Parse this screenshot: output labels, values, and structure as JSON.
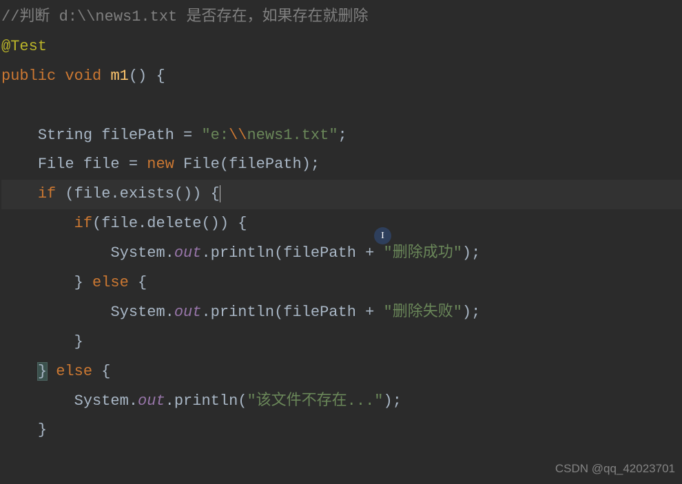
{
  "code": {
    "line1_comment_prefix": "//",
    "line1_comment_zh1": "判断 ",
    "line1_comment_path": "d:\\\\news1.txt ",
    "line1_comment_zh2": "是否存在，如果存在就删除",
    "line2_annotation": "@Test",
    "line3_kw_public": "public",
    "line3_kw_void": "void",
    "line3_method": "m1",
    "line3_parens_brace": "() {",
    "line4_empty": "",
    "line5_indent": "    ",
    "line5_type": "String ",
    "line5_var": "filePath = ",
    "line5_str_quote1": "\"",
    "line5_str_e": "e:",
    "line5_str_esc1": "\\\\",
    "line5_str_rest": "news1.txt",
    "line5_str_quote2": "\"",
    "line5_semi": ";",
    "line6_indent": "    ",
    "line6_type": "File ",
    "line6_var": "file = ",
    "line6_kw_new": "new",
    "line6_rest": " File(filePath);",
    "line7_indent": "    ",
    "line7_kw_if": "if",
    "line7_cond": " (file.exists()) ",
    "line7_brace": "{",
    "line8_indent": "        ",
    "line8_kw_if": "if",
    "line8_cond": "(file.delete()) {",
    "line9_indent": "            ",
    "line9_sys": "System.",
    "line9_out": "out",
    "line9_println": ".println(filePath + ",
    "line9_str": "\"删除成功\"",
    "line9_end": ");",
    "line10_indent": "        ",
    "line10_brace": "} ",
    "line10_kw_else": "else",
    "line10_brace2": " {",
    "line11_indent": "            ",
    "line11_sys": "System.",
    "line11_out": "out",
    "line11_println": ".println(filePath + ",
    "line11_str": "\"删除失败\"",
    "line11_end": ");",
    "line12_indent": "        ",
    "line12_brace": "}",
    "line13_indent": "    ",
    "line13_brace": "}",
    "line13_sp": " ",
    "line13_kw_else": "else",
    "line13_brace2": " {",
    "line14_indent": "        ",
    "line14_sys": "System.",
    "line14_out": "out",
    "line14_println": ".println(",
    "line14_str": "\"该文件不存在...\"",
    "line14_end": ");",
    "line15_indent": "    ",
    "line15_brace": "}"
  },
  "watermark": "CSDN @qq_42023701",
  "cursor_char": "I"
}
